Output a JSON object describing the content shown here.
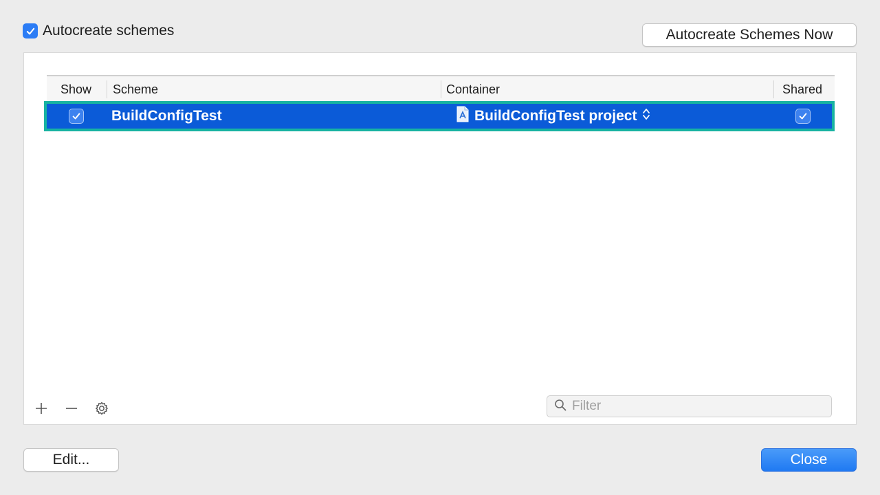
{
  "autocreate": {
    "label": "Autocreate schemes",
    "checked": true
  },
  "top_button": {
    "label": "Autocreate Schemes Now"
  },
  "table": {
    "columns": {
      "show": "Show",
      "scheme": "Scheme",
      "container": "Container",
      "shared": "Shared"
    },
    "rows": [
      {
        "show": true,
        "scheme": "BuildConfigTest",
        "container": "BuildConfigTest project",
        "shared": true,
        "selected": true
      }
    ]
  },
  "filter": {
    "placeholder": "Filter",
    "value": ""
  },
  "toolbar": {
    "add_icon": "plus-icon",
    "remove_icon": "minus-icon",
    "settings_icon": "gear-icon"
  },
  "buttons": {
    "edit": "Edit...",
    "close": "Close"
  },
  "colors": {
    "selection": "#0b5bd8",
    "highlight_border": "#18b3a1",
    "accent": "#2b7cf5"
  }
}
